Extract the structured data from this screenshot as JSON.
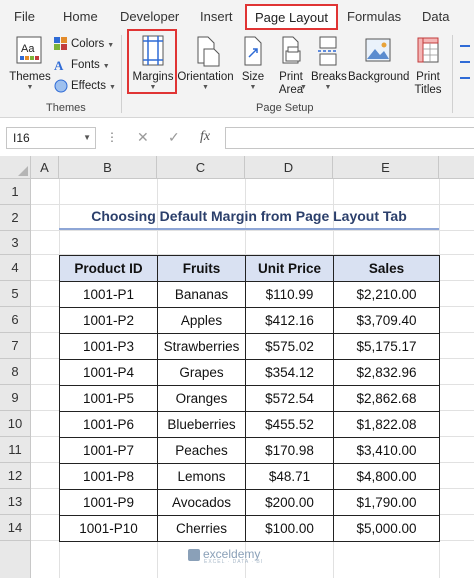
{
  "ribbon": {
    "tabs": [
      "File",
      "Home",
      "Developer",
      "Insert",
      "Page Layout",
      "Formulas",
      "Data"
    ],
    "active_tab": "Page Layout",
    "themes_group": {
      "themes_label": "Themes",
      "colors_label": "Colors",
      "fonts_label": "Fonts",
      "effects_label": "Effects",
      "group_label": "Themes"
    },
    "page_setup_group": {
      "margins_label": "Margins",
      "orientation_label": "Orientation",
      "size_label": "Size",
      "print_area_line1": "Print",
      "print_area_line2": "Area",
      "breaks_label": "Breaks",
      "background_label": "Background",
      "print_titles_line1": "Print",
      "print_titles_line2": "Titles",
      "group_label": "Page Setup"
    },
    "highlight_color": "#e03434"
  },
  "formula_bar": {
    "name_box": "I16",
    "fx_label": "fx",
    "value": ""
  },
  "sheet": {
    "columns": [
      "A",
      "B",
      "C",
      "D",
      "E"
    ],
    "rows": [
      "1",
      "2",
      "3",
      "4",
      "5",
      "6",
      "7",
      "8",
      "9",
      "10",
      "11",
      "12",
      "13",
      "14"
    ],
    "title": "Choosing Default Margin from Page Layout Tab",
    "headers": [
      "Product ID",
      "Fruits",
      "Unit Price",
      "Sales"
    ],
    "table_rows": [
      [
        "1001-P1",
        "Bananas",
        "$110.99",
        "$2,210.00"
      ],
      [
        "1001-P2",
        "Apples",
        "$412.16",
        "$3,709.40"
      ],
      [
        "1001-P3",
        "Strawberries",
        "$575.02",
        "$5,175.17"
      ],
      [
        "1001-P4",
        "Grapes",
        "$354.12",
        "$2,832.96"
      ],
      [
        "1001-P5",
        "Oranges",
        "$572.54",
        "$2,862.68"
      ],
      [
        "1001-P6",
        "Blueberries",
        "$455.52",
        "$1,822.08"
      ],
      [
        "1001-P7",
        "Peaches",
        "$170.98",
        "$3,410.00"
      ],
      [
        "1001-P8",
        "Lemons",
        "$48.71",
        "$4,800.00"
      ],
      [
        "1001-P9",
        "Avocados",
        "$200.00",
        "$1,790.00"
      ],
      [
        "1001-P10",
        "Cherries",
        "$100.00",
        "$5,000.00"
      ]
    ],
    "header_fill": "#d9e1f2"
  },
  "watermark": {
    "brand": "exceldemy",
    "tagline": "EXCEL · DATA · BI"
  }
}
